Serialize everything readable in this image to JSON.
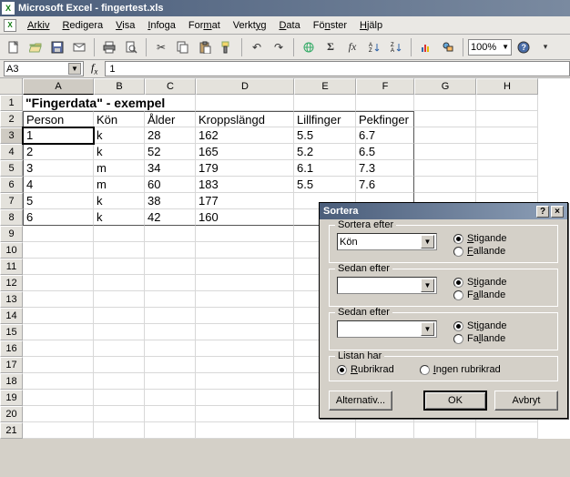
{
  "app": {
    "title": "Microsoft Excel - fingertest.xls",
    "icon_letter": "X",
    "window_icon_letter": "X"
  },
  "menubar": {
    "items": [
      {
        "label": "Arkiv",
        "u": 0
      },
      {
        "label": "Redigera",
        "u": 0
      },
      {
        "label": "Visa",
        "u": 0
      },
      {
        "label": "Infoga",
        "u": 0
      },
      {
        "label": "Format",
        "u": 3
      },
      {
        "label": "Verktyg",
        "u": 5
      },
      {
        "label": "Data",
        "u": 0
      },
      {
        "label": "Fönster",
        "u": 2
      },
      {
        "label": "Hjälp",
        "u": 0
      }
    ]
  },
  "toolbar": {
    "zoom": "100%"
  },
  "namebox": "A3",
  "formula": "1",
  "columns": [
    "A",
    "B",
    "C",
    "D",
    "E",
    "F",
    "G",
    "H"
  ],
  "sheet": {
    "title": "\"Fingerdata\" - exempel",
    "headers": [
      "Person",
      "Kön",
      "Ålder",
      "Kroppslängd",
      "Lillfinger",
      "Pekfinger"
    ],
    "rows": [
      {
        "person": "1",
        "kon": "k",
        "alder": "28",
        "langd": "162",
        "lill": "5.5",
        "pek": "6.7"
      },
      {
        "person": "2",
        "kon": "k",
        "alder": "52",
        "langd": "165",
        "lill": "5.2",
        "pek": "6.5"
      },
      {
        "person": "3",
        "kon": "m",
        "alder": "34",
        "langd": "179",
        "lill": "6.1",
        "pek": "7.3"
      },
      {
        "person": "4",
        "kon": "m",
        "alder": "60",
        "langd": "183",
        "lill": "5.5",
        "pek": "7.6"
      },
      {
        "person": "5",
        "kon": "k",
        "alder": "38",
        "langd": "177",
        "lill": "",
        "pek": ""
      },
      {
        "person": "6",
        "kon": "k",
        "alder": "42",
        "langd": "160",
        "lill": "",
        "pek": ""
      }
    ],
    "row_numbers": [
      "1",
      "2",
      "3",
      "4",
      "5",
      "6",
      "7",
      "8",
      "9",
      "10",
      "11",
      "12",
      "13",
      "14",
      "15",
      "16",
      "17",
      "18",
      "19",
      "20",
      "21"
    ]
  },
  "dialog": {
    "title": "Sortera",
    "group1_label": "Sortera efter",
    "group1_value": "Kön",
    "group2_label": "Sedan efter",
    "group2_value": "",
    "group3_label": "Sedan efter",
    "group3_value": "",
    "asc_label": "Stigande",
    "desc_label": "Fallande",
    "asc_u": 0,
    "desc_u": 0,
    "list_label": "Listan har",
    "header_opt": "Rubrikrad",
    "noheader_opt": "Ingen rubrikrad",
    "btn_options": "Alternativ...",
    "btn_ok": "OK",
    "btn_cancel": "Avbryt"
  }
}
